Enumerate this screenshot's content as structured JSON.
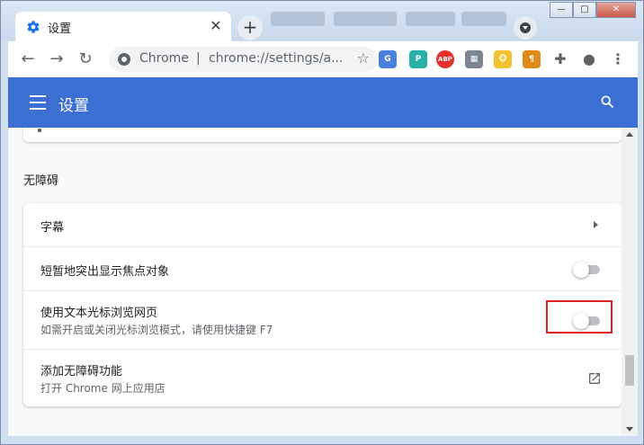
{
  "tab": {
    "title": "设置",
    "close": "✕"
  },
  "newtab": {
    "label": "+"
  },
  "window": {
    "minimize": "—",
    "maximize": "□",
    "close": "✕"
  },
  "toolbar": {
    "back": "←",
    "forward": "→",
    "reload": "↻",
    "omnibox_label": "Chrome",
    "omnibox_sep": "|",
    "url": "chrome://settings/a...",
    "star": "☆"
  },
  "extensions": [
    {
      "name": "translate",
      "text": "G",
      "color": "#4a7fe0"
    },
    {
      "name": "p-ext",
      "text": "P",
      "color": "#27b0a8"
    },
    {
      "name": "adblock",
      "text": "ABP",
      "color": "#e8302a"
    },
    {
      "name": "ext-grid",
      "text": "▦",
      "color": "#7c8590"
    },
    {
      "name": "ext-monkey",
      "text": "🐵",
      "color": "#f1c232"
    },
    {
      "name": "ext-pilcrow",
      "text": "¶",
      "color": "#e08a1a"
    },
    {
      "name": "puzzle",
      "text": "✚",
      "color": "#5f6368"
    },
    {
      "name": "avatar",
      "text": "●",
      "color": "#5f6368"
    },
    {
      "name": "more",
      "text": "⋮",
      "color": "#5f6368"
    }
  ],
  "header": {
    "title": "设置"
  },
  "section": {
    "title": "无障碍"
  },
  "rows": [
    {
      "primary": "字幕"
    },
    {
      "primary": "短暂地突出显示焦点对象",
      "toggle": false
    },
    {
      "primary": "使用文本光标浏览网页",
      "secondary": "如需开启或关闭光标浏览模式，请使用快捷键 F7",
      "toggle": false
    },
    {
      "primary": "添加无障碍功能",
      "secondary": "打开 Chrome 网上应用店"
    }
  ],
  "colors": {
    "header": "#3b6fd4",
    "highlight": "#e02020"
  }
}
